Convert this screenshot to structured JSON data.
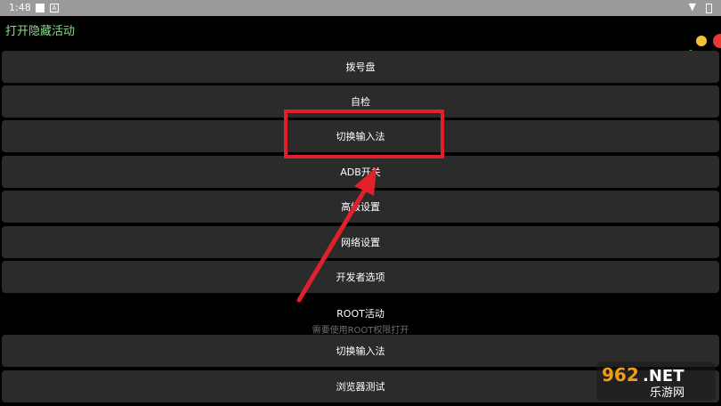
{
  "status_bar": {
    "time": "1:48",
    "icons": [
      "notification-square-icon",
      "a-badge-icon",
      "wifi-icon",
      "battery-icon"
    ]
  },
  "app": {
    "title": "打开隐藏活动",
    "title_color": "#7ee27e"
  },
  "buttons": [
    {
      "label": "拨号盘"
    },
    {
      "label": "自检"
    },
    {
      "label": "切换输入法"
    },
    {
      "label": "ADB开关"
    },
    {
      "label": "高级设置"
    },
    {
      "label": "网络设置"
    },
    {
      "label": "开发者选项"
    }
  ],
  "root_section": {
    "heading": "ROOT活动",
    "subtitle": "需要使用ROOT权限打开"
  },
  "root_buttons": [
    {
      "label": "切换输入法"
    },
    {
      "label": "浏览器测试"
    }
  ],
  "annotation": {
    "highlight_color": "#e0202a",
    "arrow_color": "#e0202a"
  },
  "watermark": {
    "text_top": "962.NET",
    "text_bottom": "乐游网"
  }
}
